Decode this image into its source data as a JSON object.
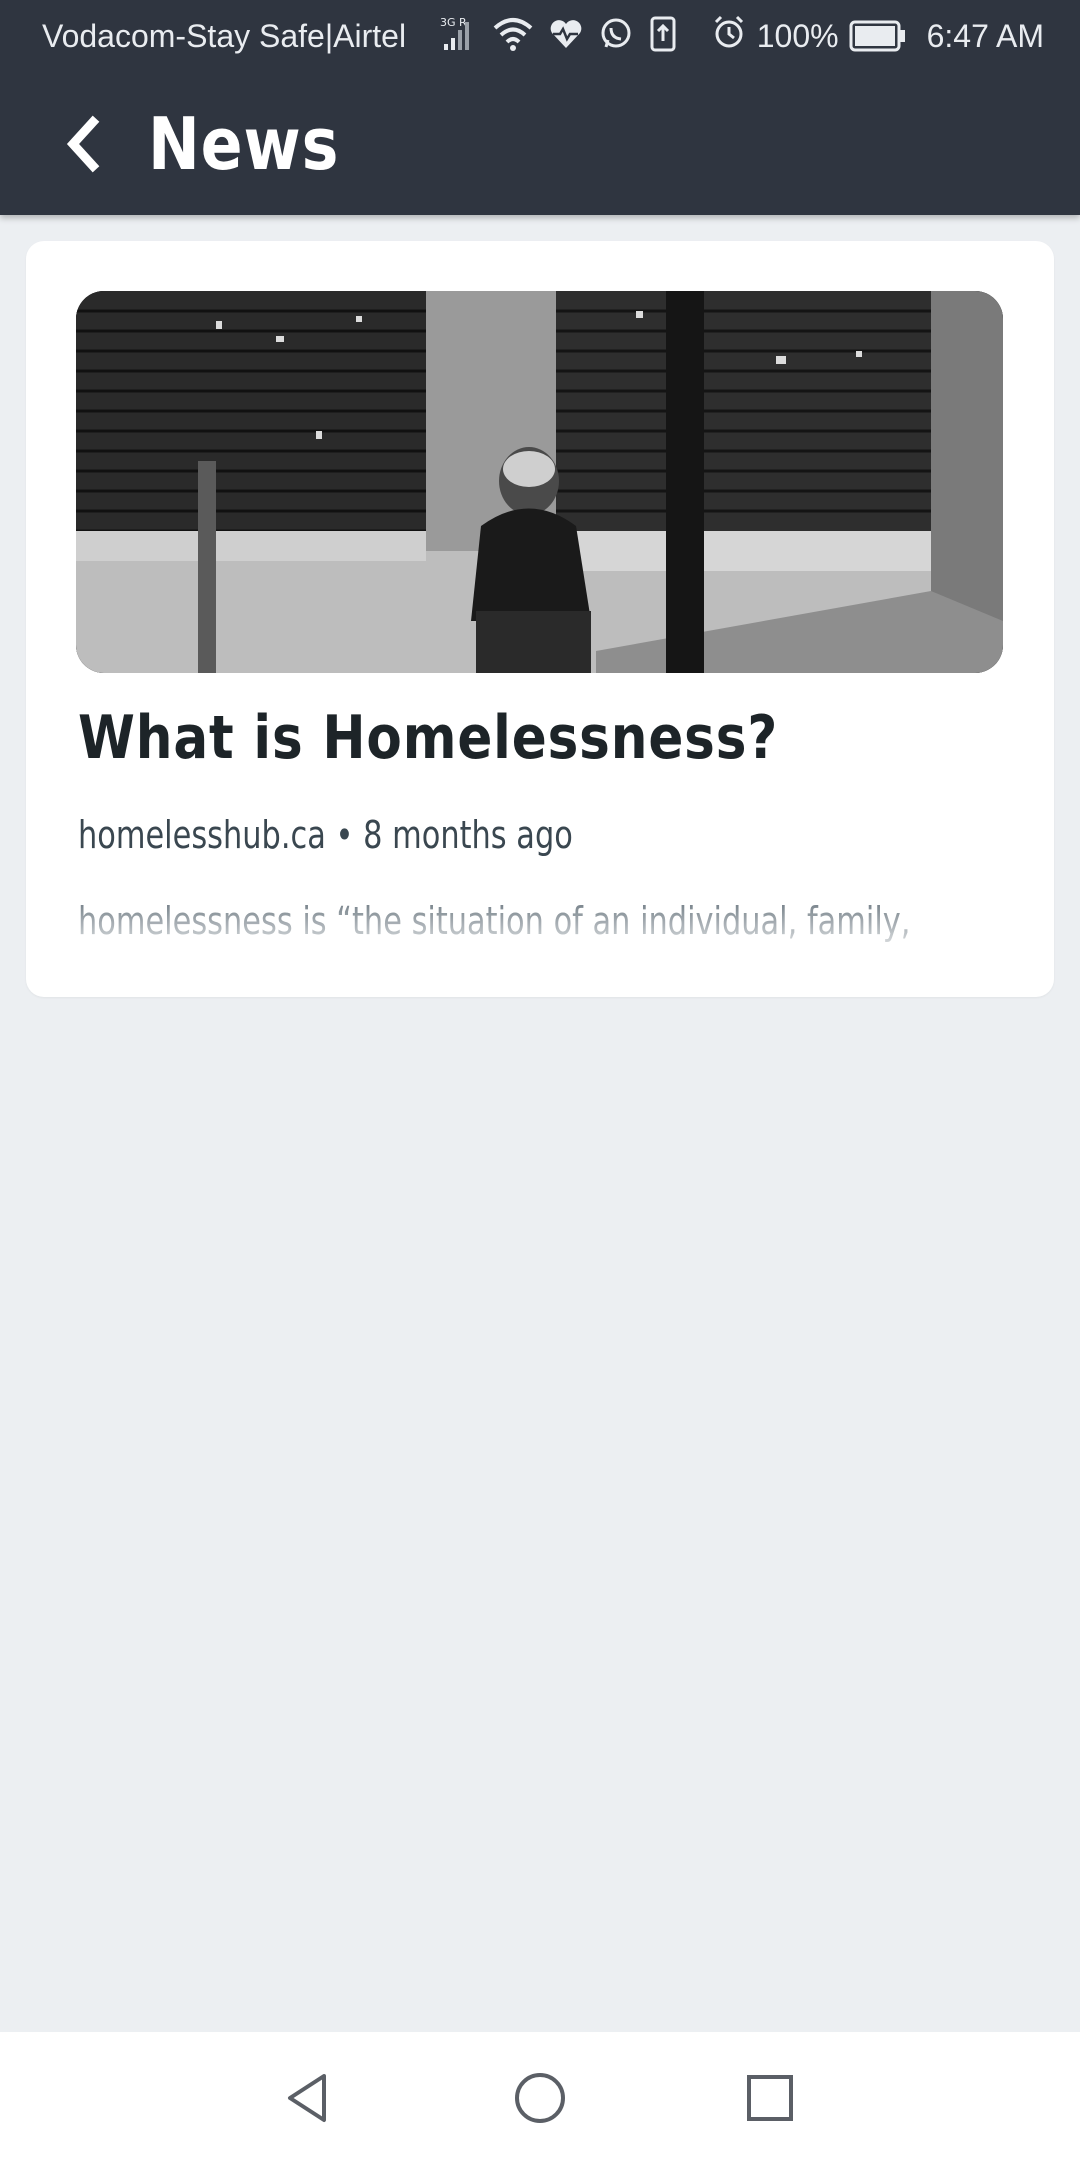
{
  "status_bar": {
    "carrier": "Vodacom-Stay Safe|Airtel",
    "network": "3G R",
    "battery": "100%",
    "time": "6:47 AM"
  },
  "app_bar": {
    "title": "News"
  },
  "article": {
    "title": "What is Homelessness?",
    "source": "homelesshub.ca",
    "separator": "•",
    "age": "8 months ago",
    "excerpt": "homelessness is “the situation of an individual, family, or"
  },
  "icons": {
    "back": "chevron-left-icon",
    "signal": "signal-icon",
    "wifi": "wifi-icon",
    "health": "heart-pulse-icon",
    "whatsapp": "whatsapp-icon",
    "upload": "upload-icon",
    "alarm": "alarm-icon",
    "battery": "battery-icon",
    "nav_back": "triangle-back-icon",
    "nav_home": "circle-home-icon",
    "nav_recents": "square-recents-icon"
  },
  "colors": {
    "app_bar": "#2f3540",
    "background": "#eceff2",
    "card": "#ffffff",
    "title_text": "#1d2428"
  }
}
